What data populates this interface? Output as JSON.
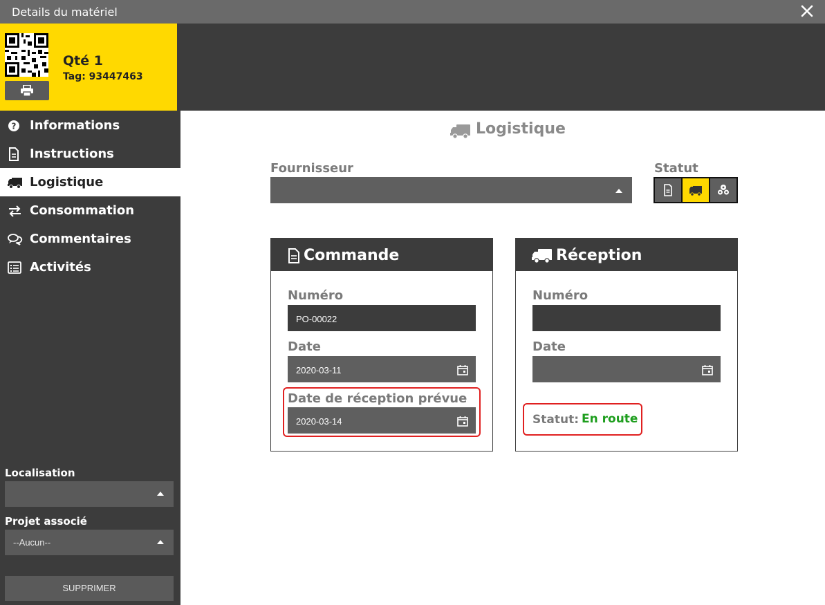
{
  "window": {
    "title": "Details du matériel"
  },
  "item": {
    "qty_label": "Qté 1",
    "tag_label": "Tag: 93447463"
  },
  "sidebar": {
    "items": [
      {
        "label": "Informations",
        "icon": "question-circle-icon"
      },
      {
        "label": "Instructions",
        "icon": "document-icon"
      },
      {
        "label": "Logistique",
        "icon": "truck-icon",
        "active": true
      },
      {
        "label": "Consommation",
        "icon": "exchange-arrows-icon"
      },
      {
        "label": "Commentaires",
        "icon": "comments-icon"
      },
      {
        "label": "Activités",
        "icon": "list-icon"
      }
    ],
    "location": {
      "label": "Localisation",
      "value": ""
    },
    "project": {
      "label": "Projet associé",
      "value": "--Aucun--"
    },
    "delete_label": "SUPPRIMER"
  },
  "main": {
    "section_title": "Logistique",
    "supplier": {
      "label": "Fournisseur",
      "value": ""
    },
    "status": {
      "label": "Statut",
      "buttons": [
        "document-icon",
        "truck-icon",
        "boxes-icon"
      ],
      "active_index": 1
    },
    "order": {
      "title": "Commande",
      "number_label": "Numéro",
      "number_value": "PO-00022",
      "date_label": "Date",
      "date_value": "2020-03-11",
      "expected_label": "Date de réception prévue",
      "expected_value": "2020-03-14"
    },
    "reception": {
      "title": "Réception",
      "number_label": "Numéro",
      "number_value": "",
      "date_label": "Date",
      "date_value": "",
      "status_label": "Statut:",
      "status_value": "En route"
    }
  },
  "colors": {
    "accent_yellow": "#ffd900",
    "dark": "#3c3c3c",
    "status_green": "#1e9e1e",
    "highlight_red": "#e02020"
  }
}
